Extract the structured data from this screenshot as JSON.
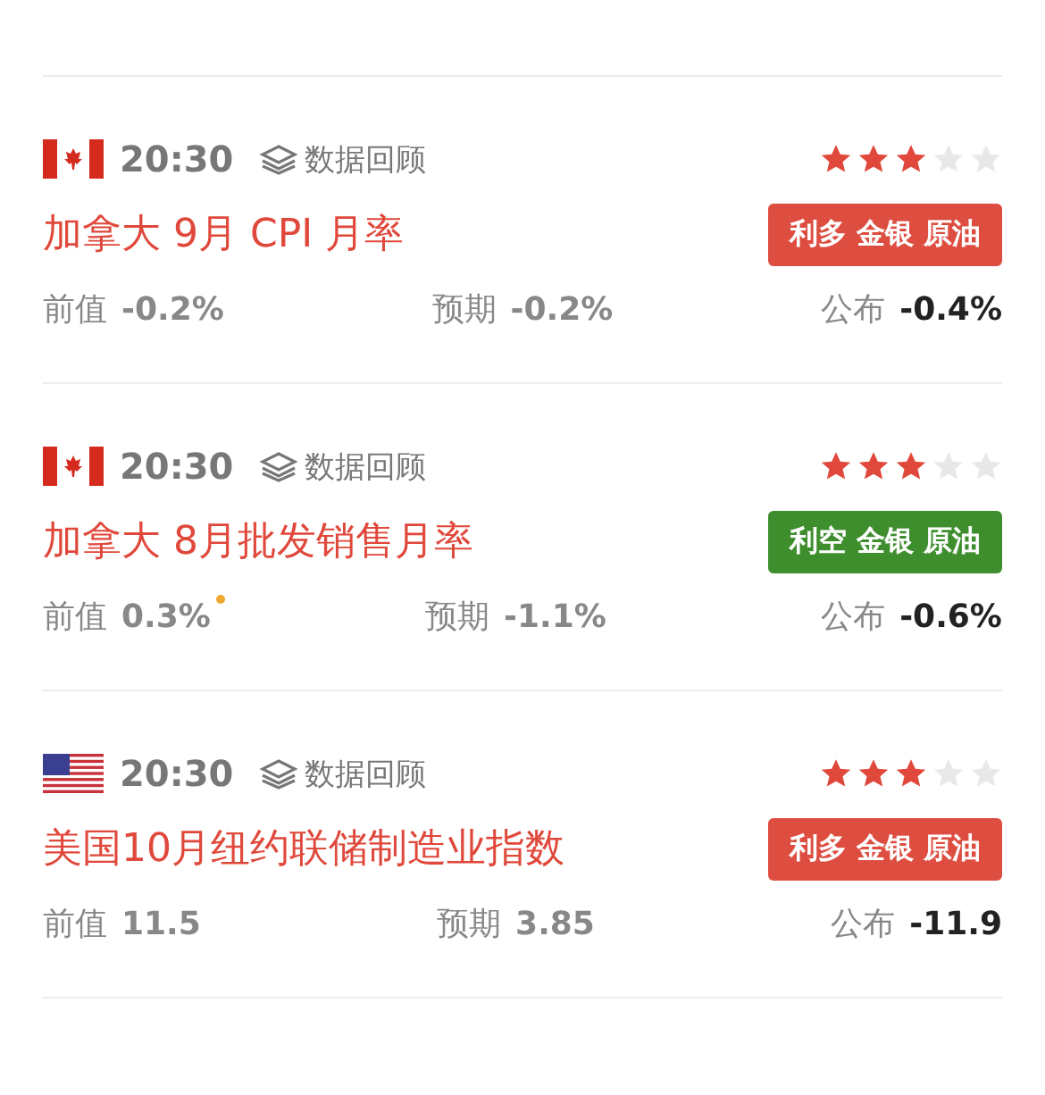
{
  "events": [
    {
      "flag": {
        "kind": "ca"
      },
      "time": "20:30",
      "review": "数据回顾",
      "stars": 3,
      "title": "加拿大 9月 CPI 月率",
      "badge": {
        "text": "利多 金银 原油",
        "kind": "bullish"
      },
      "previous": {
        "label": "前值",
        "value": "-0.2%",
        "revised": false
      },
      "forecast": {
        "label": "预期",
        "value": "-0.2%"
      },
      "actual": {
        "label": "公布",
        "value": "-0.4%"
      }
    },
    {
      "flag": {
        "kind": "ca"
      },
      "time": "20:30",
      "review": "数据回顾",
      "stars": 3,
      "title": "加拿大 8月批发销售月率",
      "badge": {
        "text": "利空 金银 原油",
        "kind": "bearish"
      },
      "previous": {
        "label": "前值",
        "value": "0.3%",
        "revised": true
      },
      "forecast": {
        "label": "预期",
        "value": "-1.1%"
      },
      "actual": {
        "label": "公布",
        "value": "-0.6%"
      }
    },
    {
      "flag": {
        "kind": "us"
      },
      "time": "20:30",
      "review": "数据回顾",
      "stars": 3,
      "title": "美国10月纽约联储制造业指数",
      "badge": {
        "text": "利多 金银 原油",
        "kind": "bullish"
      },
      "previous": {
        "label": "前值",
        "value": "11.5",
        "revised": false
      },
      "forecast": {
        "label": "预期",
        "value": "3.85"
      },
      "actual": {
        "label": "公布",
        "value": "-11.9"
      }
    }
  ]
}
